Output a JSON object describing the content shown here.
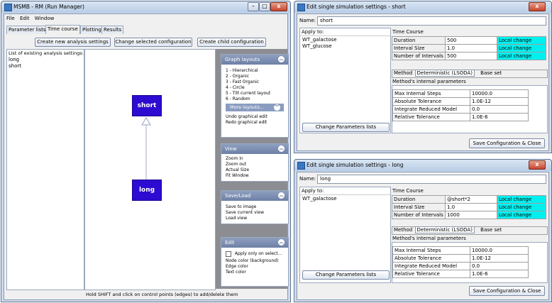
{
  "main_window": {
    "title": "MSMB - RM (Run Manager)",
    "menu": [
      "File",
      "Edit",
      "Window"
    ],
    "tabs": [
      "Parameter lists",
      "Time course",
      "Plotting",
      "Results"
    ],
    "active_tab": "Time course",
    "buttons": {
      "create_new": "Create new analysis settings",
      "change_selected": "Change selected configuration",
      "create_child": "Create child configuration"
    },
    "list_label": "List of existing analysis settings:",
    "list_items": [
      "long",
      "short"
    ],
    "nodes": {
      "top": "short",
      "bottom": "long"
    },
    "status_text": "Hold SHIFT and click on control points (edges) to add/delete them",
    "graph_layouts": {
      "header": "Graph layouts",
      "items": [
        "1 - Hierarchical",
        "2 - Organic",
        "3 - Fast Organic",
        "4 - Circle",
        "5 - Tilt current layout",
        "6 - Random"
      ],
      "more_button": "More layouts...",
      "extra": [
        "Undo graphical edit",
        "Redo graphical edit"
      ]
    },
    "view": {
      "header": "View",
      "items": [
        "Zoom in",
        "Zoom out",
        "Actual Size",
        "Fit Window"
      ]
    },
    "saveload": {
      "header": "Save/Load",
      "items": [
        "Save to image",
        "Save current view",
        "Load view"
      ]
    },
    "edit": {
      "header": "Edit",
      "checkbox": "Apply only on select...",
      "items": [
        "Node color (background)",
        "Edge color",
        "Text color"
      ]
    }
  },
  "dialog_short": {
    "title": "Edit single simulation settings - short",
    "name_label": "Name:",
    "name_value": "short",
    "apply_label": "Apply to:",
    "apply_items": [
      "WT_galactose",
      "WT_glucose"
    ],
    "change_params_button": "Change Parameters lists",
    "time_course_label": "Time Course",
    "rows": [
      {
        "label": "Duration",
        "value": "500",
        "status": "Local change"
      },
      {
        "label": "Interval Size",
        "value": "1.0",
        "status": "Local change"
      },
      {
        "label": "Number of Intervals",
        "value": "500",
        "status": "Local change"
      }
    ],
    "method_label": "Method",
    "method_value": "Deterministic (LSODA)",
    "base_set": "Base set",
    "internal_params_label": "Method's internal parameters",
    "params": [
      {
        "name": "Max Internal Steps",
        "value": "10000.0"
      },
      {
        "name": "Absolute Tolerance",
        "value": "1.0E-12"
      },
      {
        "name": "Integrate Reduced Model",
        "value": "0.0"
      },
      {
        "name": "Relative Tolerance",
        "value": "1.0E-6"
      }
    ],
    "save_button": "Save Configuration & Close"
  },
  "dialog_long": {
    "title": "Edit single simulation settings - long",
    "name_label": "Name:",
    "name_value": "long",
    "apply_label": "Apply to:",
    "apply_items": [
      "WT_galactose"
    ],
    "change_params_button": "Change Parameters lists",
    "time_course_label": "Time Course",
    "rows": [
      {
        "label": "Duration",
        "value": "@short*2",
        "status": "Local change"
      },
      {
        "label": "Interval Size",
        "value": "1.0",
        "status": "Local change"
      },
      {
        "label": "Number of Intervals",
        "value": "1000",
        "status": "Local change"
      }
    ],
    "method_label": "Method",
    "method_value": "Deterministic (LSODA)",
    "base_set": "Base set",
    "internal_params_label": "Method's internal parameters",
    "params": [
      {
        "name": "Max Internal Steps",
        "value": "10000.0"
      },
      {
        "name": "Absolute Tolerance",
        "value": "1.0E-12"
      },
      {
        "name": "Integrate Reduced Model",
        "value": "0.0"
      },
      {
        "name": "Relative Tolerance",
        "value": "1.0E-6"
      }
    ],
    "save_button": "Save Configuration & Close"
  },
  "window_controls": {
    "minimize": "–",
    "maximize": "□",
    "close": "x"
  }
}
